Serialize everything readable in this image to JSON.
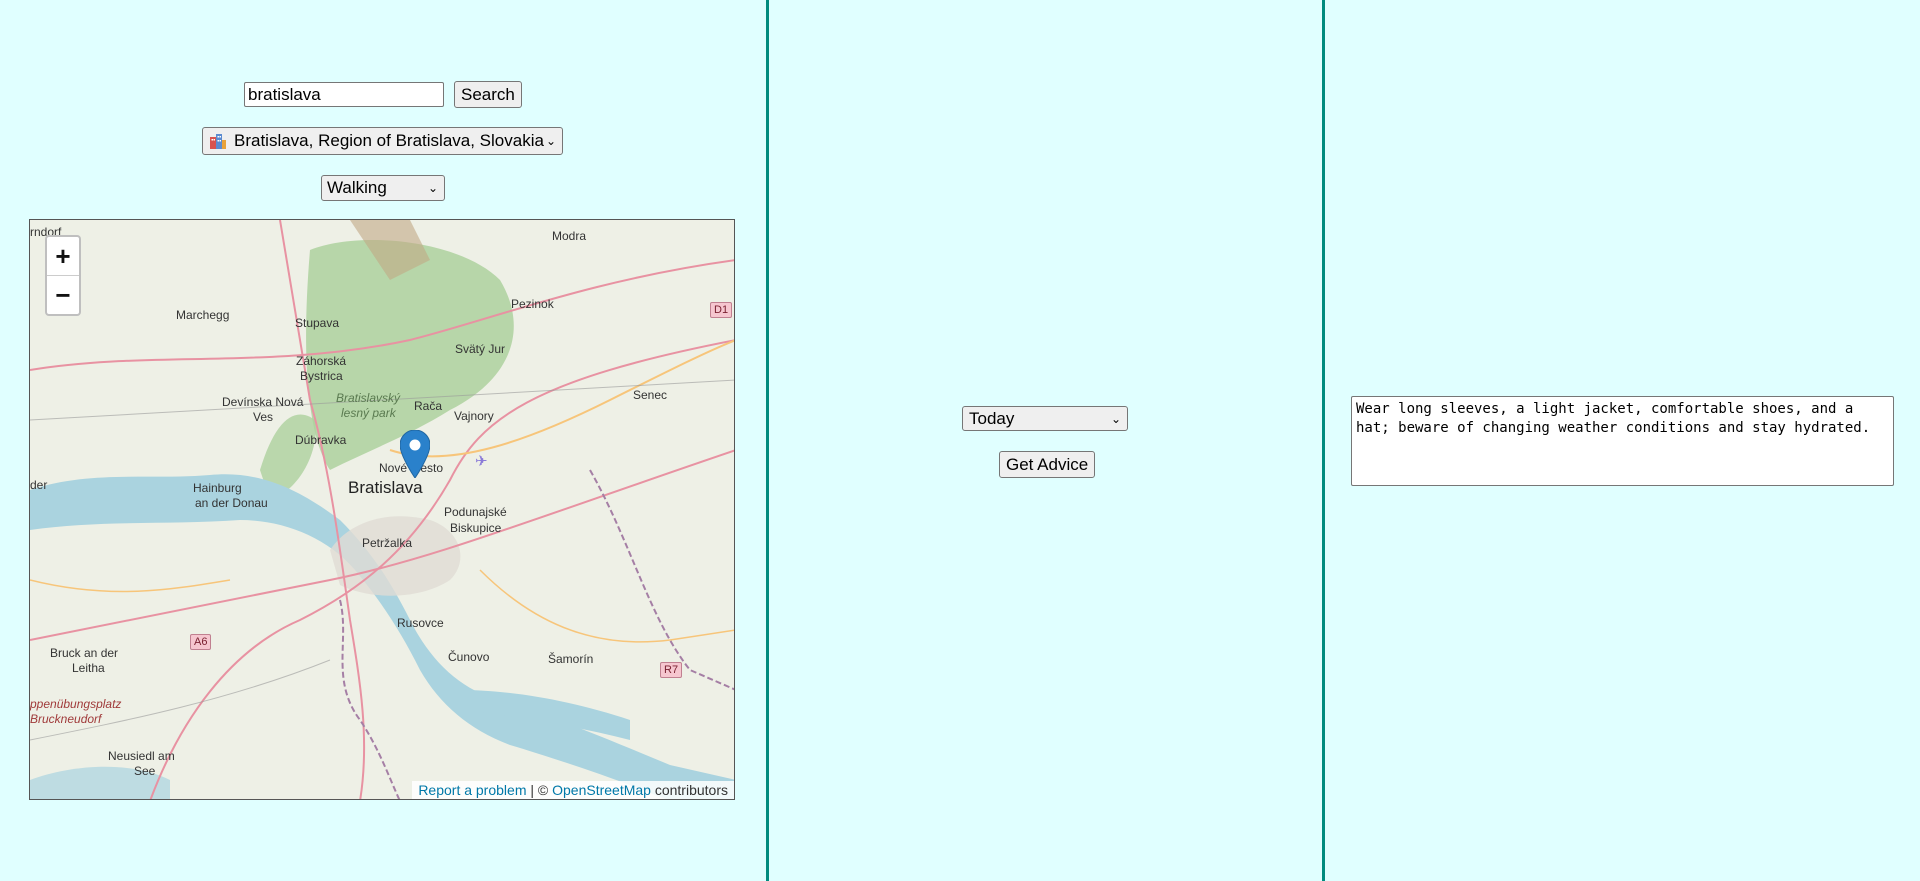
{
  "search": {
    "query": "bratislava",
    "button_label": "Search"
  },
  "location": {
    "selected": "Bratislava, Region of Bratislava, Slovakia",
    "icon": "city-icon"
  },
  "travel_mode": {
    "selected": "Walking"
  },
  "map": {
    "zoom_in": "+",
    "zoom_out": "−",
    "attribution": {
      "report": "Report a problem",
      "sep": " | © ",
      "osm": "OpenStreetMap",
      "suffix": " contributors"
    },
    "labels": {
      "city": "Bratislava",
      "nove_mesto": "Nové Mesto",
      "raca": "Rača",
      "vajnory": "Vajnory",
      "petrzalka": "Petržalka",
      "podunajske": "Podunajské",
      "biskupice": "Biskupice",
      "dubravka": "Dúbravka",
      "devinska1": "Devínska Nová",
      "devinska2": "Ves",
      "hainburg1": "Hainburg",
      "hainburg2": "an der Donau",
      "marchegg": "Marchegg",
      "stupava": "Stupava",
      "zahorska1": "Záhorská",
      "zahorska2": "Bystrica",
      "park1": "Bratislavský",
      "park2": "lesný park",
      "svaty_jur": "Svätý Jur",
      "pezinok": "Pezinok",
      "modra": "Modra",
      "senec": "Senec",
      "rusovce": "Rusovce",
      "cunovo": "Čunovo",
      "samorin": "Šamorín",
      "bruck1": "Bruck an der",
      "bruck2": "Leitha",
      "uebung1": "ppenübungsplatz",
      "uebung2": "Bruckneudorf",
      "neusiedl1": "Neusiedl am",
      "neusiedl2": "See",
      "arndorf": "rndorf",
      "der": "der",
      "d1": "D1",
      "a6": "A6",
      "r7": "R7"
    }
  },
  "day": {
    "selected": "Today"
  },
  "advice": {
    "button_label": "Get Advice",
    "text": "Wear long sleeves, a light jacket, comfortable shoes, and a hat; beware of changing weather conditions and stay hydrated."
  },
  "colors": {
    "background": "#e0ffff",
    "divider": "#008b7e",
    "marker": "#2a81cb"
  }
}
